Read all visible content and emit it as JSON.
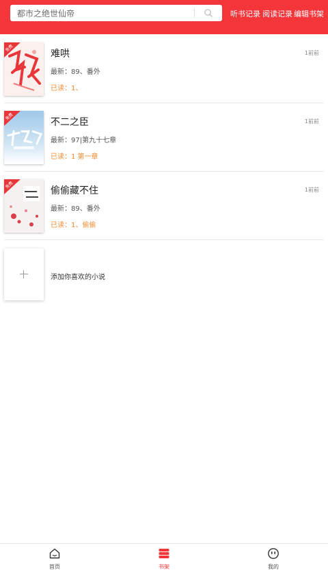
{
  "header": {
    "search_text": "都市之绝世仙帝",
    "links": [
      "听书记录",
      "阅读记录",
      "编辑书架"
    ]
  },
  "books": [
    {
      "title": "难哄",
      "latest": "最新：89、番外",
      "read": "已读：1、",
      "time": "1前前",
      "cover_badge": "免费",
      "cover_colors": [
        "#fbf0ee",
        "#e8373b"
      ]
    },
    {
      "title": "不二之臣",
      "latest": "最新：97|第九十七章",
      "read": "已读：1 第一章",
      "time": "1前前",
      "cover_badge": "免费",
      "cover_colors": [
        "#a9cde9",
        "#ffffff"
      ]
    },
    {
      "title": "偷偷藏不住",
      "latest": "最新：89、番外",
      "read": "已读：1、偷偷",
      "time": "1前前",
      "cover_badge": "免费",
      "cover_colors": [
        "#f4f1f0",
        "#d9404a"
      ]
    }
  ],
  "add_item": {
    "label": "添加你喜欢的小说",
    "icon": "plus-icon"
  },
  "tabs": [
    {
      "label": "首页",
      "icon": "home-icon",
      "active": false
    },
    {
      "label": "书架",
      "icon": "bookshelf-icon",
      "active": true
    },
    {
      "label": "我的",
      "icon": "profile-icon",
      "active": false
    }
  ],
  "colors": {
    "brand": "#f4363b",
    "read_accent": "#f38a2e"
  }
}
